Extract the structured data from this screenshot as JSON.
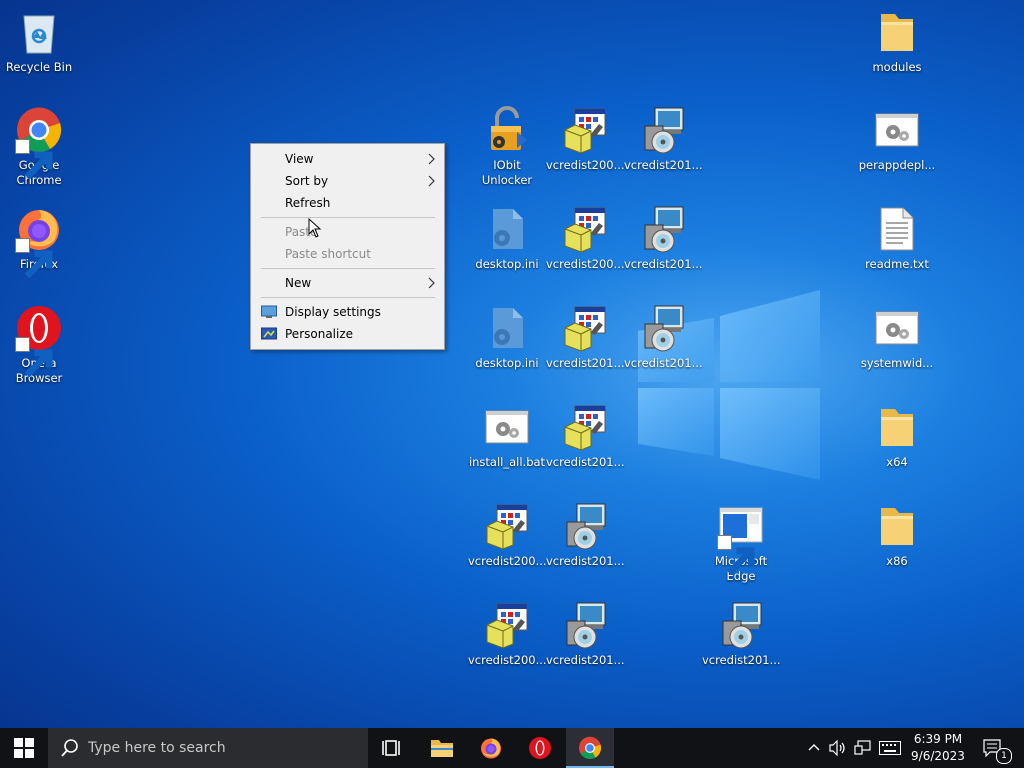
{
  "desktop": {
    "icons": [
      {
        "label": "Recycle Bin",
        "icon": "recycle-bin-icon"
      },
      {
        "label": "Google Chrome",
        "icon": "chrome-icon"
      },
      {
        "label": "Firefox",
        "icon": "firefox-icon"
      },
      {
        "label": "Opera Browser",
        "icon": "opera-icon"
      },
      {
        "label": "IObit Unlocker",
        "icon": "unlocker-icon"
      },
      {
        "label": "vcredist200...",
        "icon": "installer-icon"
      },
      {
        "label": "vcredist201...",
        "icon": "setup-cd-icon"
      },
      {
        "label": "desktop.ini",
        "icon": "config-file-icon"
      },
      {
        "label": "vcredist200...",
        "icon": "installer-icon"
      },
      {
        "label": "vcredist201...",
        "icon": "setup-cd-icon"
      },
      {
        "label": "desktop.ini",
        "icon": "config-file-icon"
      },
      {
        "label": "vcredist201...",
        "icon": "installer-icon"
      },
      {
        "label": "vcredist201...",
        "icon": "setup-cd-icon"
      },
      {
        "label": "install_all.bat",
        "icon": "batch-file-icon"
      },
      {
        "label": "vcredist201...",
        "icon": "installer-icon"
      },
      {
        "label": "vcredist200...",
        "icon": "installer-icon"
      },
      {
        "label": "vcredist201...",
        "icon": "setup-cd-icon"
      },
      {
        "label": "vcredist200...",
        "icon": "installer-icon"
      },
      {
        "label": "vcredist201...",
        "icon": "setup-cd-icon"
      },
      {
        "label": "Microsoft Edge",
        "icon": "edge-icon"
      },
      {
        "label": "vcredist201...",
        "icon": "setup-cd-icon"
      },
      {
        "label": "modules",
        "icon": "folder-icon"
      },
      {
        "label": "perappdepl...",
        "icon": "batch-file-icon"
      },
      {
        "label": "readme.txt",
        "icon": "text-file-icon"
      },
      {
        "label": "systemwid...",
        "icon": "batch-file-icon"
      },
      {
        "label": "x64",
        "icon": "folder-icon"
      },
      {
        "label": "x86",
        "icon": "folder-icon"
      }
    ]
  },
  "context_menu": {
    "view": "View",
    "sort_by": "Sort by",
    "refresh": "Refresh",
    "paste": "Paste",
    "paste_shortcut": "Paste shortcut",
    "new": "New",
    "display_settings": "Display settings",
    "personalize": "Personalize"
  },
  "taskbar": {
    "search_placeholder": "Type here to search",
    "apps": [
      "task-view-icon",
      "file-explorer-icon",
      "firefox-icon",
      "opera-icon",
      "chrome-icon"
    ],
    "clock_time": "6:39 PM",
    "clock_date": "9/6/2023",
    "notification_count": "1"
  },
  "colors": {
    "desktop_blue": "#0a5fc9",
    "taskbar": "#101216",
    "menu_bg": "#f0f0f0"
  }
}
